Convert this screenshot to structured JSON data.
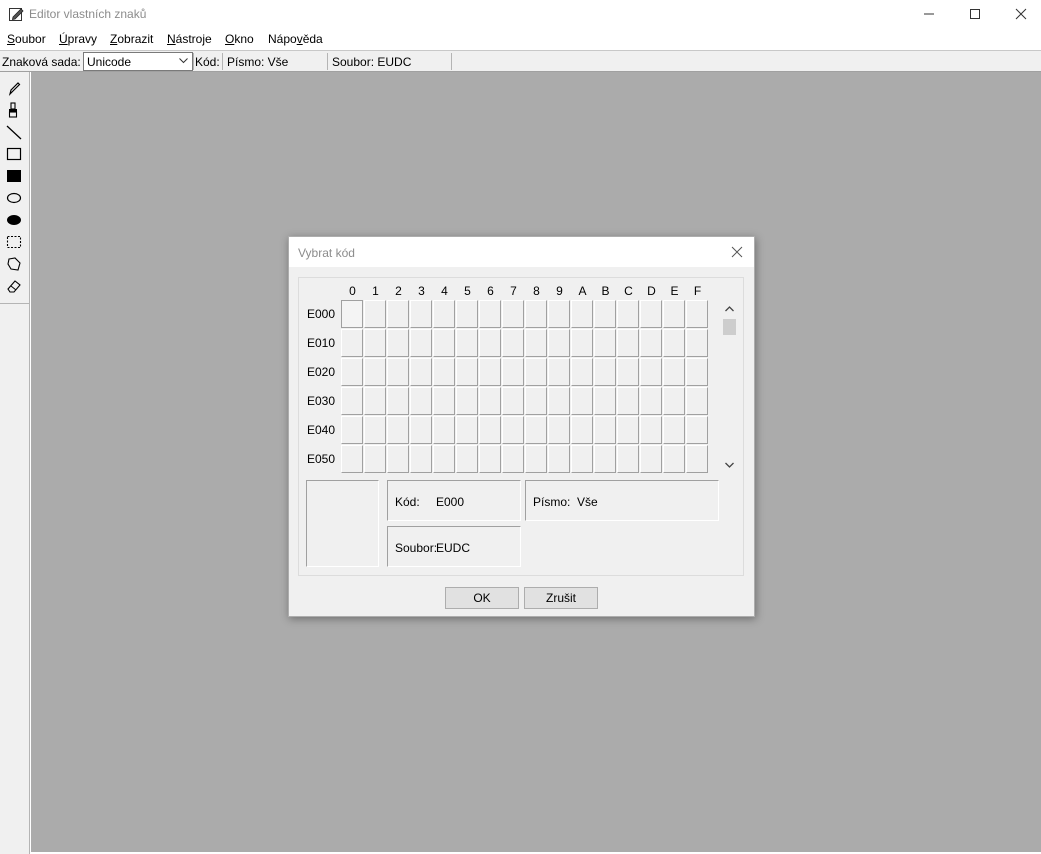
{
  "window": {
    "title": "Editor vlastních znaků"
  },
  "menu": {
    "items": [
      {
        "pre": "",
        "u": "S",
        "post": "oubor"
      },
      {
        "pre": "",
        "u": "Ú",
        "post": "pravy"
      },
      {
        "pre": "",
        "u": "Z",
        "post": "obrazit"
      },
      {
        "pre": "",
        "u": "N",
        "post": "ástroje"
      },
      {
        "pre": "",
        "u": "O",
        "post": "kno"
      },
      {
        "pre": "Nápo",
        "u": "v",
        "post": "ěda"
      }
    ]
  },
  "infobar": {
    "charset_label": "Znaková sada:",
    "charset_value": "Unicode",
    "kod_label": "Kód:",
    "pismo": "Písmo: Vše",
    "soubor": "Soubor: EUDC"
  },
  "toolbox": {
    "tools": [
      "pencil-icon",
      "brush-icon",
      "line-icon",
      "hollow-rectangle-icon",
      "filled-rectangle-icon",
      "hollow-ellipse-icon",
      "filled-ellipse-icon",
      "rectangular-selection-icon",
      "freeform-selection-icon",
      "eraser-icon"
    ]
  },
  "dialog": {
    "title": "Vybrat kód",
    "columns": [
      "0",
      "1",
      "2",
      "3",
      "4",
      "5",
      "6",
      "7",
      "8",
      "9",
      "A",
      "B",
      "C",
      "D",
      "E",
      "F"
    ],
    "rows": [
      "E000",
      "E010",
      "E020",
      "E030",
      "E040",
      "E050"
    ],
    "selected_code": "E000",
    "kod_label": "Kód:",
    "kod_value": "E000",
    "pismo_label": "Písmo:",
    "pismo_value": "Vše",
    "soubor_label": "Soubor:",
    "soubor_value": "EUDC",
    "ok_label": "OK",
    "cancel_label": "Zrušit"
  }
}
